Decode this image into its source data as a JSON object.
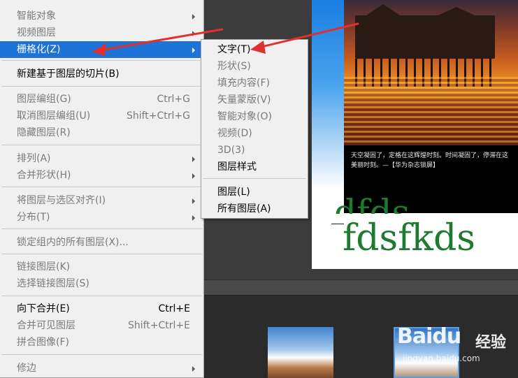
{
  "main_menu": {
    "items": [
      {
        "label": "智能对象",
        "shortcut": "",
        "submenu": true,
        "enabled": false
      },
      {
        "label": "视频图层",
        "shortcut": "",
        "submenu": true,
        "enabled": false
      },
      {
        "label": "栅格化(Z)",
        "shortcut": "",
        "submenu": true,
        "enabled": true,
        "highlighted": true
      },
      {
        "label": "新建基于图层的切片(B)",
        "shortcut": "",
        "submenu": false,
        "enabled": true
      },
      {
        "label": "图层编组(G)",
        "shortcut": "Ctrl+G",
        "submenu": false,
        "enabled": false
      },
      {
        "label": "取消图层编组(U)",
        "shortcut": "Shift+Ctrl+G",
        "submenu": false,
        "enabled": false
      },
      {
        "label": "隐藏图层(R)",
        "shortcut": "",
        "submenu": false,
        "enabled": false
      },
      {
        "label": "排列(A)",
        "shortcut": "",
        "submenu": true,
        "enabled": false
      },
      {
        "label": "合并形状(H)",
        "shortcut": "",
        "submenu": true,
        "enabled": false
      },
      {
        "label": "将图层与选区对齐(I)",
        "shortcut": "",
        "submenu": true,
        "enabled": false
      },
      {
        "label": "分布(T)",
        "shortcut": "",
        "submenu": true,
        "enabled": false
      },
      {
        "label": "锁定组内的所有图层(X)...",
        "shortcut": "",
        "submenu": false,
        "enabled": false
      },
      {
        "label": "链接图层(K)",
        "shortcut": "",
        "submenu": false,
        "enabled": false
      },
      {
        "label": "选择链接图层(S)",
        "shortcut": "",
        "submenu": false,
        "enabled": false
      },
      {
        "label": "向下合并(E)",
        "shortcut": "Ctrl+E",
        "submenu": false,
        "enabled": true
      },
      {
        "label": "合并可见图层",
        "shortcut": "Shift+Ctrl+E",
        "submenu": false,
        "enabled": false
      },
      {
        "label": "拼合图像(F)",
        "shortcut": "",
        "submenu": false,
        "enabled": false
      },
      {
        "label": "修边",
        "shortcut": "",
        "submenu": true,
        "enabled": false
      }
    ]
  },
  "sub_menu": {
    "items": [
      {
        "label": "文字(T)",
        "enabled": true
      },
      {
        "label": "形状(S)",
        "enabled": false
      },
      {
        "label": "填充内容(F)",
        "enabled": false
      },
      {
        "label": "矢量蒙版(V)",
        "enabled": false
      },
      {
        "label": "智能对象(O)",
        "enabled": false
      },
      {
        "label": "视频(D)",
        "enabled": false
      },
      {
        "label": "3D(3)",
        "enabled": false
      },
      {
        "label": "图层样式",
        "enabled": true
      },
      {
        "label": "图层(L)",
        "enabled": true
      },
      {
        "label": "所有图层(A)",
        "enabled": true
      }
    ]
  },
  "canvas": {
    "caption_line1": "天空凝固了，定格在这辉煌时刻。时间凝固了，停滞在这",
    "caption_line2": "美丽时刻。—【华为杂志锁屏】",
    "text_line1": "dfds",
    "text_line2": "fdsfkds"
  },
  "watermark": {
    "logo": "Baidu",
    "product": "经验",
    "url": "jingyan.baidu.com"
  },
  "colors": {
    "menu_highlight": "#1e73d6",
    "annotation_arrow": "#e03030",
    "canvas_text": "#1e7a2e"
  }
}
